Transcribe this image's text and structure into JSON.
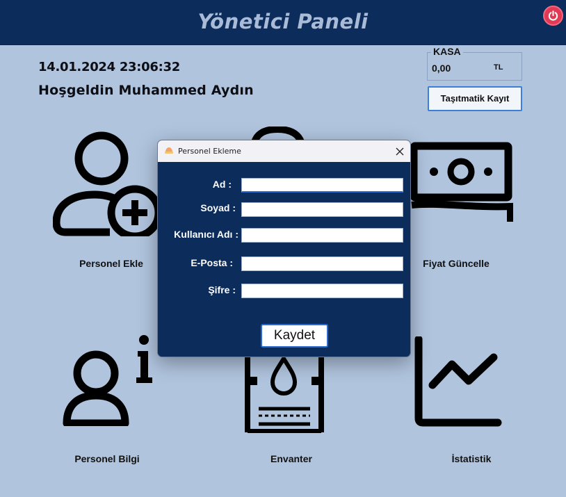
{
  "header": {
    "title": "Yönetici Paneli",
    "power_icon": "power-icon"
  },
  "info": {
    "datetime": "14.01.2024 23:06:32",
    "welcome": "Hoşgeldin Muhammed Aydın"
  },
  "kasa": {
    "label": "KASA",
    "value": "0,00",
    "unit": "TL"
  },
  "actions": {
    "tasimatik_label": "Taşıtmatik Kayıt"
  },
  "tiles": [
    {
      "label": "Personel Ekle",
      "icon": "add-user-icon"
    },
    {
      "label": "Fiyat Güncelle",
      "icon": "money-icon"
    },
    {
      "label": "Personel Bilgi",
      "icon": "user-info-icon"
    },
    {
      "label": "Envanter",
      "icon": "fuel-tank-icon"
    },
    {
      "label": "İstatistik",
      "icon": "chart-icon"
    }
  ],
  "modal": {
    "title": "Personel Ekleme",
    "fields": [
      {
        "label": "Ad :",
        "value": ""
      },
      {
        "label": "Soyad :",
        "value": ""
      },
      {
        "label": "Kullanıcı Adı :",
        "value": ""
      },
      {
        "label": "E-Posta :",
        "value": ""
      },
      {
        "label": "Şifre :",
        "value": ""
      }
    ],
    "save_label": "Kaydet"
  },
  "colors": {
    "header_bg": "#0c2c5c",
    "body_bg": "#b0c4de",
    "accent": "#2a6ad1",
    "power": "#e23a55"
  }
}
